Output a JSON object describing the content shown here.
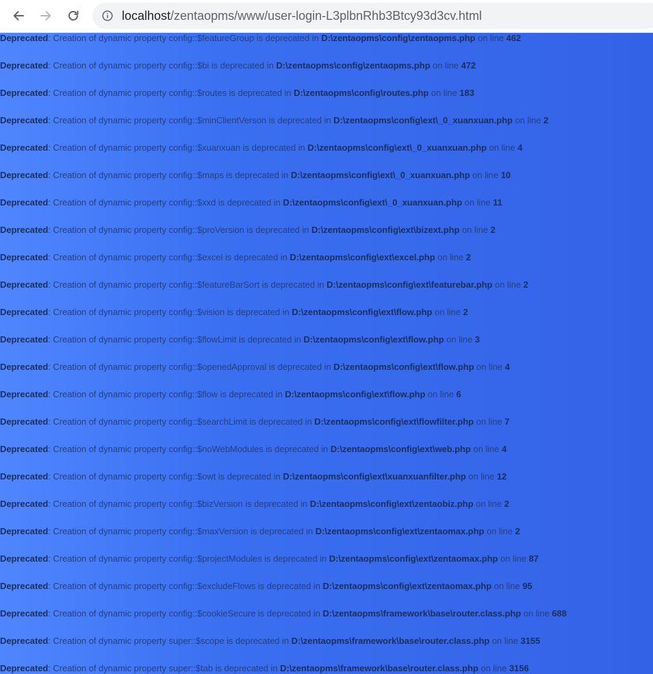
{
  "browser": {
    "url_host": "localhost",
    "url_path": "/zentaopms/www/user-login-L3plbnRhb3Btcy93d3cv.html",
    "icons": [
      "back-arrow-icon",
      "forward-arrow-icon",
      "reload-icon",
      "info-icon"
    ]
  },
  "warnings": [
    {
      "label": "Deprecated",
      "message": ": Creation of dynamic property config::$featureGroup is deprecated in ",
      "file": "D:\\zentaopms\\config\\zentaopms.php",
      "on_line_text": " on line ",
      "line": "462"
    },
    {
      "label": "Deprecated",
      "message": ": Creation of dynamic property config::$bi is deprecated in ",
      "file": "D:\\zentaopms\\config\\zentaopms.php",
      "on_line_text": " on line ",
      "line": "472"
    },
    {
      "label": "Deprecated",
      "message": ": Creation of dynamic property config::$routes is deprecated in ",
      "file": "D:\\zentaopms\\config\\routes.php",
      "on_line_text": " on line ",
      "line": "183"
    },
    {
      "label": "Deprecated",
      "message": ": Creation of dynamic property config::$minClientVerson is deprecated in ",
      "file": "D:\\zentaopms\\config\\ext\\_0_xuanxuan.php",
      "on_line_text": " on line ",
      "line": "2"
    },
    {
      "label": "Deprecated",
      "message": ": Creation of dynamic property config::$xuanxuan is deprecated in ",
      "file": "D:\\zentaopms\\config\\ext\\_0_xuanxuan.php",
      "on_line_text": " on line ",
      "line": "4"
    },
    {
      "label": "Deprecated",
      "message": ": Creation of dynamic property config::$maps is deprecated in ",
      "file": "D:\\zentaopms\\config\\ext\\_0_xuanxuan.php",
      "on_line_text": " on line ",
      "line": "10"
    },
    {
      "label": "Deprecated",
      "message": ": Creation of dynamic property config::$xxd is deprecated in ",
      "file": "D:\\zentaopms\\config\\ext\\_0_xuanxuan.php",
      "on_line_text": " on line ",
      "line": "11"
    },
    {
      "label": "Deprecated",
      "message": ": Creation of dynamic property config::$proVersion is deprecated in ",
      "file": "D:\\zentaopms\\config\\ext\\bizext.php",
      "on_line_text": " on line ",
      "line": "2"
    },
    {
      "label": "Deprecated",
      "message": ": Creation of dynamic property config::$excel is deprecated in ",
      "file": "D:\\zentaopms\\config\\ext\\excel.php",
      "on_line_text": " on line ",
      "line": "2"
    },
    {
      "label": "Deprecated",
      "message": ": Creation of dynamic property config::$featureBarSort is deprecated in ",
      "file": "D:\\zentaopms\\config\\ext\\featurebar.php",
      "on_line_text": " on line ",
      "line": "2"
    },
    {
      "label": "Deprecated",
      "message": ": Creation of dynamic property config::$vision is deprecated in ",
      "file": "D:\\zentaopms\\config\\ext\\flow.php",
      "on_line_text": " on line ",
      "line": "2"
    },
    {
      "label": "Deprecated",
      "message": ": Creation of dynamic property config::$flowLimit is deprecated in ",
      "file": "D:\\zentaopms\\config\\ext\\flow.php",
      "on_line_text": " on line ",
      "line": "3"
    },
    {
      "label": "Deprecated",
      "message": ": Creation of dynamic property config::$openedApproval is deprecated in ",
      "file": "D:\\zentaopms\\config\\ext\\flow.php",
      "on_line_text": " on line ",
      "line": "4"
    },
    {
      "label": "Deprecated",
      "message": ": Creation of dynamic property config::$flow is deprecated in ",
      "file": "D:\\zentaopms\\config\\ext\\flow.php",
      "on_line_text": " on line ",
      "line": "6"
    },
    {
      "label": "Deprecated",
      "message": ": Creation of dynamic property config::$searchLimit is deprecated in ",
      "file": "D:\\zentaopms\\config\\ext\\flowfilter.php",
      "on_line_text": " on line ",
      "line": "7"
    },
    {
      "label": "Deprecated",
      "message": ": Creation of dynamic property config::$noWebModules is deprecated in ",
      "file": "D:\\zentaopms\\config\\ext\\web.php",
      "on_line_text": " on line ",
      "line": "4"
    },
    {
      "label": "Deprecated",
      "message": ": Creation of dynamic property config::$owt is deprecated in ",
      "file": "D:\\zentaopms\\config\\ext\\xuanxuanfilter.php",
      "on_line_text": " on line ",
      "line": "12"
    },
    {
      "label": "Deprecated",
      "message": ": Creation of dynamic property config::$bizVersion is deprecated in ",
      "file": "D:\\zentaopms\\config\\ext\\zentaobiz.php",
      "on_line_text": " on line ",
      "line": "2"
    },
    {
      "label": "Deprecated",
      "message": ": Creation of dynamic property config::$maxVersion is deprecated in ",
      "file": "D:\\zentaopms\\config\\ext\\zentaomax.php",
      "on_line_text": " on line ",
      "line": "2"
    },
    {
      "label": "Deprecated",
      "message": ": Creation of dynamic property config::$projectModules is deprecated in ",
      "file": "D:\\zentaopms\\config\\ext\\zentaomax.php",
      "on_line_text": " on line ",
      "line": "87"
    },
    {
      "label": "Deprecated",
      "message": ": Creation of dynamic property config::$excludeFlows is deprecated in ",
      "file": "D:\\zentaopms\\config\\ext\\zentaomax.php",
      "on_line_text": " on line ",
      "line": "95"
    },
    {
      "label": "Deprecated",
      "message": ": Creation of dynamic property config::$cookieSecure is deprecated in ",
      "file": "D:\\zentaopms\\framework\\base\\router.class.php",
      "on_line_text": " on line ",
      "line": "688"
    },
    {
      "label": "Deprecated",
      "message": ": Creation of dynamic property super::$scope is deprecated in ",
      "file": "D:\\zentaopms\\framework\\base\\router.class.php",
      "on_line_text": " on line ",
      "line": "3155"
    },
    {
      "label": "Deprecated",
      "message": ": Creation of dynamic property super::$tab is deprecated in ",
      "file": "D:\\zentaopms\\framework\\base\\router.class.php",
      "on_line_text": " on line ",
      "line": "3156"
    }
  ]
}
